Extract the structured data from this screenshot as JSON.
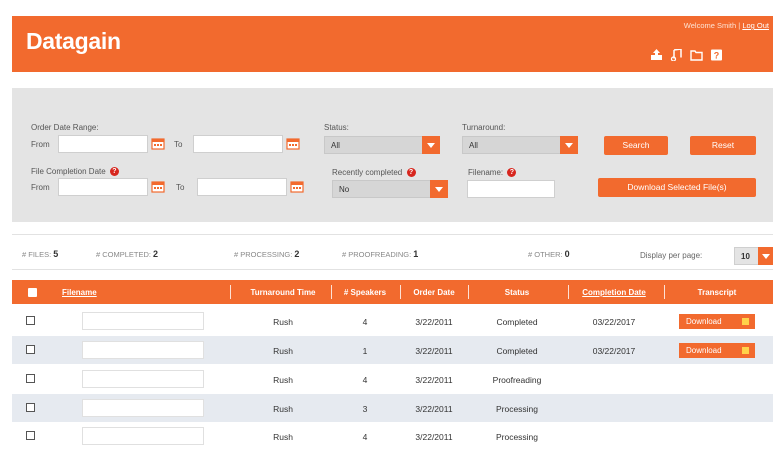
{
  "app": {
    "logo": "Datagain",
    "welcome_text": "Welcome Smith |",
    "logout": "Log Out",
    "header_icons": [
      "upload-icon",
      "music-note-icon",
      "folder-icon",
      "help-icon"
    ],
    "brand_color": "#f26a2e"
  },
  "filters": {
    "order_date_range_label": "Order Date Range:",
    "from_label": "From",
    "to_label": "To",
    "status_label": "Status:",
    "status_value": "All",
    "turnaround_label": "Turnaround:",
    "turnaround_value": "All",
    "search_button": "Search",
    "reset_button": "Reset",
    "file_completion_label": "File Completion Date",
    "from2_label": "From",
    "to2_label": "To",
    "recently_completed_label": "Recently completed",
    "recently_completed_value": "No",
    "filename_label": "Filename:",
    "download_selected_button": "Download Selected File(s)"
  },
  "stats": {
    "files_label": "# FILES:",
    "files_count": "5",
    "completed_label": "# COMPLETED:",
    "completed_count": "2",
    "processing_label": "# PROCESSING:",
    "processing_count": "2",
    "proofreading_label": "# PROOFREADING:",
    "proofreading_count": "1",
    "other_label": "# OTHER:",
    "other_count": "0",
    "display_per_page_label": "Display per page:",
    "per_page_value": "10"
  },
  "table": {
    "headers": [
      "Filename",
      "Turnaround Time",
      "# Speakers",
      "Order Date",
      "Status",
      "Completion Date",
      "Transcript"
    ],
    "download_label": "Download",
    "rows": [
      {
        "turnaround": "Rush",
        "speakers": "4",
        "order_date": "3/22/2011",
        "status": "Completed",
        "completion_date": "03/22/2017",
        "has_download": true
      },
      {
        "turnaround": "Rush",
        "speakers": "1",
        "order_date": "3/22/2011",
        "status": "Completed",
        "completion_date": "03/22/2017",
        "has_download": true
      },
      {
        "turnaround": "Rush",
        "speakers": "4",
        "order_date": "3/22/2011",
        "status": "Proofreading",
        "completion_date": "",
        "has_download": false
      },
      {
        "turnaround": "Rush",
        "speakers": "3",
        "order_date": "3/22/2011",
        "status": "Processing",
        "completion_date": "",
        "has_download": false
      },
      {
        "turnaround": "Rush",
        "speakers": "4",
        "order_date": "3/22/2011",
        "status": "Processing",
        "completion_date": "",
        "has_download": false
      }
    ]
  }
}
